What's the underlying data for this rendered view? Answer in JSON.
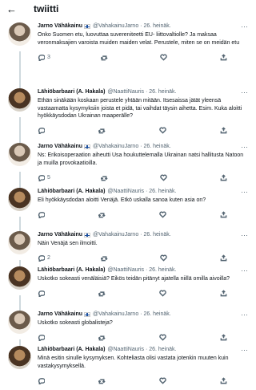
{
  "header": {
    "back_icon": "arrow-left-icon",
    "title": "twiitti"
  },
  "tweets": [
    {
      "author": "Jarno Vähäkainu",
      "flag": true,
      "handle": "@VahakainuJarno",
      "time": "26. heinäk.",
      "avatar": "jarno",
      "thread": true,
      "text": "Onko Suomen etu, luovuttaa suvereniteetti EU- liittovaltiolle? Ja maksaa veronmaksajien varoista muiden maiden velat. Perustele, miten se on meidän etu",
      "reply_count": "3",
      "retweet_count": "",
      "like_count": "",
      "share_count": ""
    },
    {
      "author": "Lähiöbarbaari (A. Hakala)",
      "flag": false,
      "handle": "@NaattiNauris",
      "time": "26. heinäk.",
      "avatar": "hakala",
      "thread": true,
      "text": "Ethän sinäkään koskaan perustele yhtään mitään. Itsesaissa jätät yleensä vastaamatta kysymyksiin joista et pidä, tai vaihdat täysin aihetta. Esim. Kuka aloitti hyökkäysdodan Ukrainan maaperälle?",
      "reply_count": "",
      "retweet_count": "",
      "like_count": "",
      "share_count": ""
    },
    {
      "author": "Jarno Vähäkainu",
      "flag": true,
      "handle": "@VahakainuJarno",
      "time": "26. heinäk.",
      "avatar": "jarno",
      "thread": true,
      "text": "Ns: Erikoisoperaation aiheutti Usa houkuttelemalla Ukrainan natsi hallitusta Natoon ja muilla provokaatioilla.",
      "reply_count": "5",
      "retweet_count": "",
      "like_count": "",
      "share_count": ""
    },
    {
      "author": "Lähiöbarbaari (A. Hakala)",
      "flag": false,
      "handle": "@NaattiNauris",
      "time": "26. heinäk.",
      "avatar": "hakala",
      "thread": true,
      "text": "Eli hyökkäysdodan aloitti Venäjä. Etkö uskalla sanoa kuten asia on?",
      "reply_count": "",
      "retweet_count": "",
      "like_count": "",
      "share_count": ""
    },
    {
      "author": "Jarno Vähäkainu",
      "flag": true,
      "handle": "@VahakainuJarno",
      "time": "26. heinäk.",
      "avatar": "jarno",
      "thread": true,
      "text": "Näin Venäjä sen ilmoitti.",
      "reply_count": "2",
      "retweet_count": "",
      "like_count": "",
      "share_count": ""
    },
    {
      "author": "Lähiöbarbaari (A. Hakala)",
      "flag": false,
      "handle": "@NaattiNauris",
      "time": "26. heinäk.",
      "avatar": "hakala",
      "thread": true,
      "text": "Uskotko sokeasti venäläisiä? Eikös teidän pitänyt ajatella niillä omilla aivoilla?",
      "reply_count": "",
      "retweet_count": "",
      "like_count": "",
      "share_count": ""
    },
    {
      "author": "Jarno Vähäkainu",
      "flag": true,
      "handle": "@VahakainuJarno",
      "time": "26. heinäk.",
      "avatar": "jarno",
      "thread": true,
      "text": "Uskotko sokeasti globalisteja?",
      "reply_count": "",
      "retweet_count": "",
      "like_count": "",
      "share_count": ""
    },
    {
      "author": "Lähiöbarbaari (A. Hakala)",
      "flag": false,
      "handle": "@NaattiNauris",
      "time": "26. heinäk.",
      "avatar": "hakala",
      "thread": false,
      "text": "Minä esitin sinulle kysymyksen. Kohteliasta olisi vastata jotenkin muuten kuin vastakysymyksellä.",
      "reply_count": "",
      "retweet_count": "",
      "like_count": "",
      "share_count": ""
    }
  ]
}
